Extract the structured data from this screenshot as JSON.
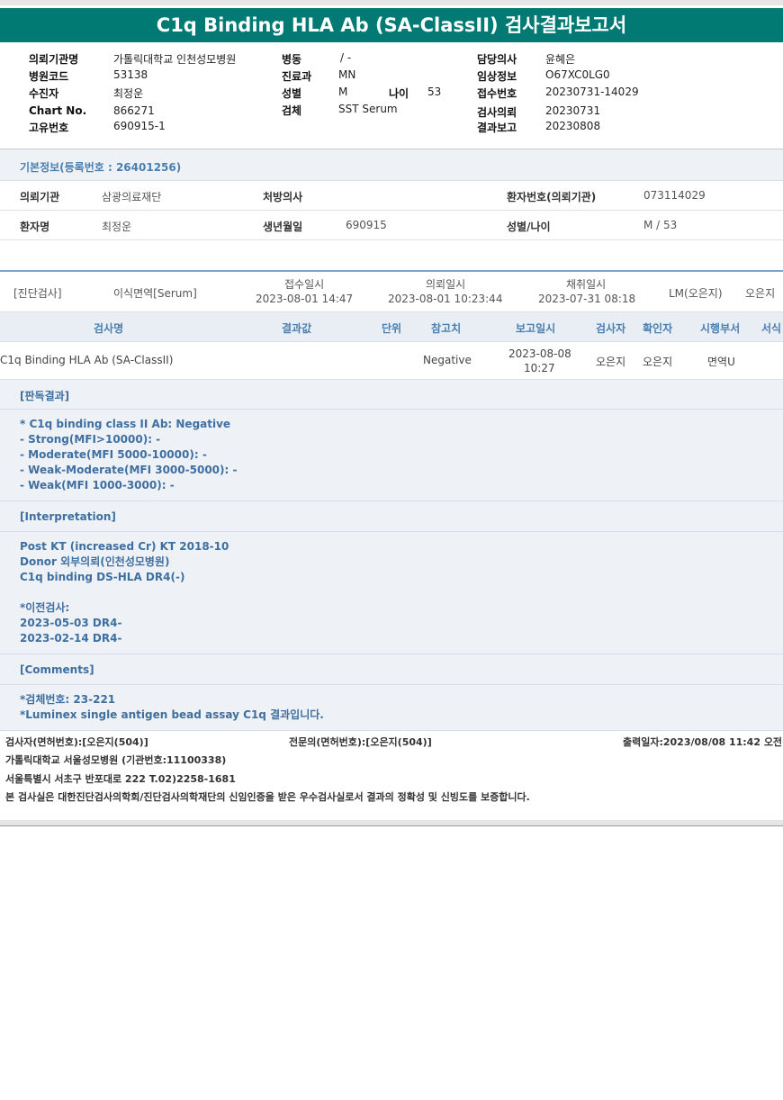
{
  "title": "C1q Binding HLA Ab (SA-ClassII) 검사결과보고서",
  "header": {
    "col1": [
      {
        "label": "의뢰기관명",
        "value": "가톨릭대학교 인천성모병원"
      },
      {
        "label": "병원코드",
        "value": "53138"
      },
      {
        "label": "수진자",
        "value": "최정운"
      },
      {
        "label": "Chart No.",
        "value": "866271"
      },
      {
        "label": "고유번호",
        "value": "690915-1"
      }
    ],
    "col2": [
      {
        "label": "병동",
        "value": "/ -"
      },
      {
        "label": "진료과",
        "value": "MN"
      },
      {
        "label": "성별",
        "value": "M"
      },
      {
        "label": "검체",
        "value": "SST Serum"
      }
    ],
    "age_label": "나이",
    "age_value": "53",
    "col3": [
      {
        "label": "담당의사",
        "value": "윤혜은"
      },
      {
        "label": "임상정보",
        "value": "O67XC0LG0"
      },
      {
        "label": "접수번호",
        "value": "20230731-14029"
      },
      {
        "label": "검사의뢰",
        "value": "20230731"
      },
      {
        "label": "결과보고",
        "value": "20230808"
      }
    ]
  },
  "basic_info": {
    "heading": "기본정보(등록번호 : 26401256)",
    "row1": {
      "l1": "의뢰기관",
      "v1": "삼광의료재단",
      "l2": "처방의사",
      "v2": "",
      "l3": "환자번호(의뢰기관)",
      "v3": "073114029"
    },
    "row2": {
      "l1": "환자명",
      "v1": "최정운",
      "l2": "생년월일",
      "v2": "690915",
      "l3": "성별/나이",
      "v3": "M / 53"
    }
  },
  "sample": {
    "category": "[진단검사]",
    "test_group": "이식면역[Serum]",
    "received_label": "접수일시",
    "received_value": "2023-08-01 14:47",
    "requested_label": "의뢰일시",
    "requested_value": "2023-08-01 10:23:44",
    "collected_label": "채취일시",
    "collected_value": "2023-07-31 08:18",
    "lm": "LM(오은지)",
    "staff": "오은지"
  },
  "columns": [
    "검사명",
    "결과값",
    "단위",
    "참고치",
    "보고일시",
    "검사자",
    "확인자",
    "시행부서",
    "서식"
  ],
  "result": {
    "test_name": "C1q Binding HLA Ab (SA-ClassII)",
    "value": "",
    "unit": "",
    "reference": "Negative",
    "report_date": "2023-08-08",
    "report_time": "10:27",
    "tester": "오은지",
    "verifier": "오은지",
    "department": "면역U",
    "form": ""
  },
  "sections": {
    "reading_title": "[판독결과]",
    "reading_body": "* C1q binding class II Ab: Negative\n- Strong(MFI>10000): -\n- Moderate(MFI 5000-10000): -\n- Weak-Moderate(MFI 3000-5000): -\n- Weak(MFI 1000-3000): -",
    "interp_title": "[Interpretation]",
    "interp_body": "Post KT (increased Cr) KT 2018-10\nDonor 외부의뢰(인천성모병원)\nC1q binding DS-HLA DR4(-)\n\n*이전검사:\n2023-05-03 DR4-\n2023-02-14 DR4-",
    "comments_title": "[Comments]",
    "comments_body": "*검체번호: 23-221\n*Luminex single antigen bead assay C1q 결과입니다."
  },
  "footer": {
    "tester": "검사자(면허번호):[오은지(504)]",
    "specialist": "전문의(면허번호):[오은지(504)]",
    "printed": "출력일자:2023/08/08 11:42 오전",
    "hospital": "가톨릭대학교 서울성모병원 (기관번호:11100338)",
    "address": "서울특별시 서초구 반포대로 222 T.02)2258-1681",
    "certification": "본 검사실은 대한진단검사의학회/진단검사의학재단의 신임인증을 받은 우수검사실로서 결과의 정확성 및 신빙도를 보증합니다."
  }
}
